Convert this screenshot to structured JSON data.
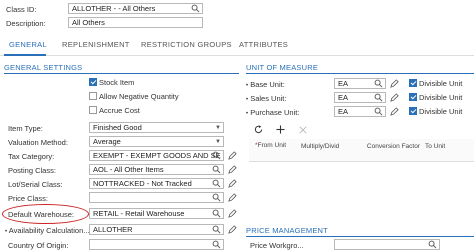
{
  "header": {
    "class_id_label": "Class ID:",
    "class_id_value": "ALLOTHER  -  - All Others",
    "description_label": "Description:",
    "description_value": "All Others"
  },
  "tabs": [
    {
      "label": "GENERAL"
    },
    {
      "label": "REPLENISHMENT"
    },
    {
      "label": "RESTRICTION GROUPS"
    },
    {
      "label": "ATTRIBUTES"
    }
  ],
  "general": {
    "title": "GENERAL SETTINGS",
    "stock_item": "Stock Item",
    "allow_negative": "Allow Negative Quantity",
    "accrue_cost": "Accrue Cost",
    "fields": [
      {
        "label": "Item Type:",
        "value": "Finished Good"
      },
      {
        "label": "Valuation Method:",
        "value": "Average"
      },
      {
        "label": "Tax Category:",
        "value": "EXEMPT - EXEMPT GOODS AND SE"
      },
      {
        "label": "Posting Class:",
        "value": "AOL - All Other Items"
      },
      {
        "label": "Lot/Serial Class:",
        "value": "NOTTRACKED - Not Tracked"
      },
      {
        "label": "Price Class:",
        "value": ""
      },
      {
        "label": "Default Warehouse:",
        "value": "RETAIL - Retail Warehouse"
      },
      {
        "label": "Availability Calculation...",
        "value": "ALLOTHER"
      },
      {
        "label": "Country Of Origin:",
        "value": ""
      }
    ]
  },
  "uom": {
    "title": "UNIT OF MEASURE",
    "base_label": "Base Unit:",
    "base_value": "EA",
    "sales_label": "Sales Unit:",
    "sales_value": "EA",
    "purchase_label": "Purchase Unit:",
    "purchase_value": "EA",
    "divisible": "Divisible Unit",
    "columns": [
      "From Unit",
      "Multiply/Divid",
      "Conversion Factor",
      "To Unit"
    ]
  },
  "price": {
    "title": "PRICE MANAGEMENT",
    "workgroup_label": "Price Workgro..."
  },
  "colors": {
    "accent": "#2a70b8",
    "highlight_oval": "#cc2222"
  }
}
